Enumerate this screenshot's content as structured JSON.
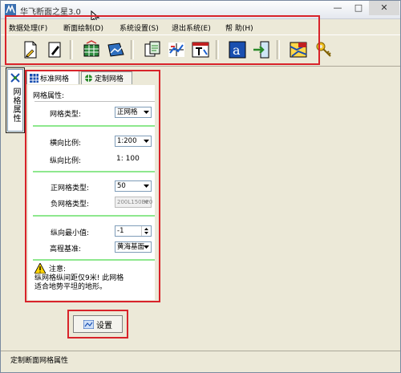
{
  "window": {
    "title": "华飞断面之星3.0"
  },
  "menu": [
    {
      "label": "数据处理(F)"
    },
    {
      "label": "断面绘制(D)"
    },
    {
      "label": "系统设置(S)"
    },
    {
      "label": "退出系统(E)"
    },
    {
      "label": "帮 助(H)"
    }
  ],
  "toolbar": {
    "icons": [
      "new-doc-icon",
      "edit-doc-icon",
      "grid-icon",
      "terrain-icon",
      "copy-icon",
      "cross-section-icon",
      "text-icon",
      "font-icon",
      "import-icon",
      "map-icon",
      "key-icon"
    ]
  },
  "side_tab": {
    "label": "网格属性"
  },
  "tabs": [
    {
      "label": "标准网格"
    },
    {
      "label": "定制网格"
    }
  ],
  "grid": {
    "section_title": "网格属性:",
    "type_label": "网格类型:",
    "type_value": "正网格",
    "h_scale_label": "横向比例:",
    "h_scale_value": "1:200",
    "v_scale_label": "纵向比例:",
    "v_scale_value": "1: 100",
    "pos_grid_label": "正网格类型:",
    "pos_grid_value": "50",
    "neg_grid_label": "负网格类型:",
    "neg_grid_value": "200L150B20",
    "v_min_label": "纵向最小值:",
    "v_min_value": "-1",
    "datum_label": "高程基准:",
    "datum_value": "黄海基面",
    "note_title": "注意:",
    "note_text": "纵网格纵间距仅9米! 此网格适合地势平坦的地形。"
  },
  "actions": {
    "settings_label": "设置"
  },
  "status": {
    "text": "定制断面网格属性"
  },
  "colors": {
    "highlight": "#d8232a",
    "divider": "#8ee88e"
  }
}
